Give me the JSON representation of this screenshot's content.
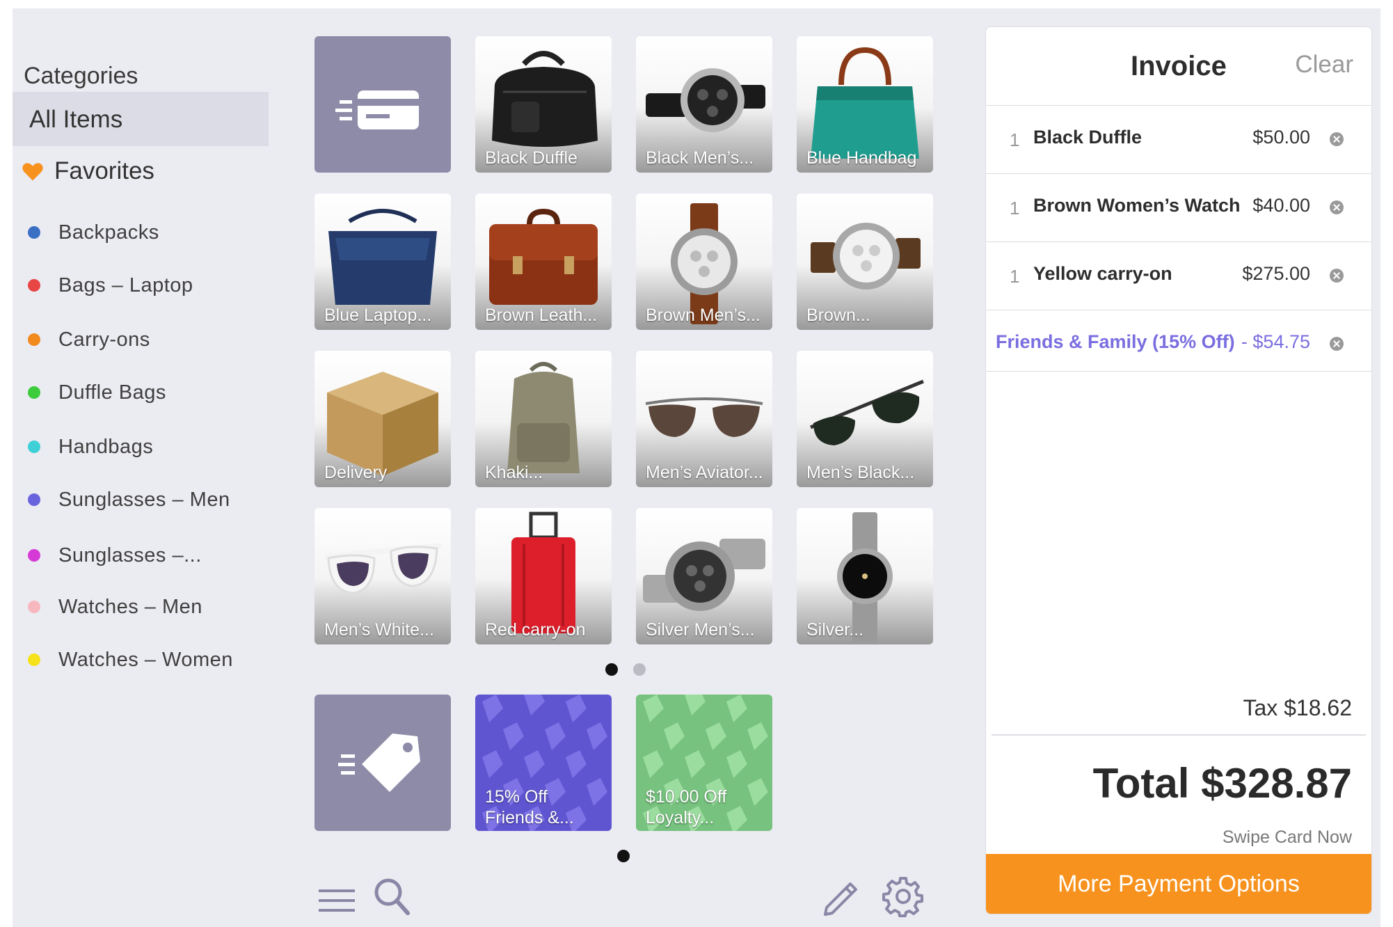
{
  "sidebar": {
    "title": "Categories",
    "all_items": "All Items",
    "favorites": "Favorites",
    "items": [
      {
        "label": "Backpacks",
        "color": "#3b6fc4"
      },
      {
        "label": "Bags – Laptop",
        "color": "#e84545"
      },
      {
        "label": "Carry-ons",
        "color": "#f2891d"
      },
      {
        "label": "Duffle Bags",
        "color": "#3ccc3c"
      },
      {
        "label": "Handbags",
        "color": "#3fcfd6"
      },
      {
        "label": "Sunglasses – Men",
        "color": "#6a63de"
      },
      {
        "label": "Sunglasses –...",
        "color": "#d63ad6"
      },
      {
        "label": "Watches – Men",
        "color": "#f7b7bf"
      },
      {
        "label": "Watches – Women",
        "color": "#f5e21a"
      }
    ]
  },
  "products": [
    {
      "label": "",
      "icon": "card-list-icon"
    },
    {
      "label": "Black Duffle",
      "icon": "duffle-bag-icon"
    },
    {
      "label": "Black Men’s...",
      "icon": "watch-icon"
    },
    {
      "label": "Blue Handbag",
      "icon": "handbag-icon"
    },
    {
      "label": "Blue Laptop...",
      "icon": "laptop-bag-icon"
    },
    {
      "label": "Brown Leath...",
      "icon": "briefcase-icon"
    },
    {
      "label": "Brown Men’s...",
      "icon": "watch-icon"
    },
    {
      "label": "Brown...",
      "icon": "watch-icon"
    },
    {
      "label": "Delivery",
      "icon": "box-icon"
    },
    {
      "label": "Khaki...",
      "icon": "backpack-icon"
    },
    {
      "label": "Men’s Aviator...",
      "icon": "aviator-sunglasses-icon"
    },
    {
      "label": "Men’s Black...",
      "icon": "sunglasses-icon"
    },
    {
      "label": "Men’s White...",
      "icon": "sunglasses-icon"
    },
    {
      "label": "Red carry-on",
      "icon": "suitcase-icon"
    },
    {
      "label": "Silver Men’s...",
      "icon": "watch-icon"
    },
    {
      "label": "Silver...",
      "icon": "watch-icon"
    }
  ],
  "discounts": [
    {
      "label": "",
      "icon": "tag-list-icon"
    },
    {
      "line1": "15% Off",
      "line2": "Friends &...",
      "color": "#5f55d1"
    },
    {
      "line1": "$10.00 Off",
      "line2": "Loyalty...",
      "color": "#76c27e"
    }
  ],
  "invoice": {
    "title": "Invoice",
    "clear": "Clear",
    "lines": [
      {
        "qty": "1",
        "name": "Black Duffle",
        "price": "$50.00"
      },
      {
        "qty": "1",
        "name": "Brown Women’s Watch",
        "price": "$40.00"
      },
      {
        "qty": "1",
        "name": "Yellow carry-on",
        "price": "$275.00"
      }
    ],
    "discount": {
      "name": "Friends & Family (15% Off)",
      "amount": "- $54.75"
    },
    "tax": "Tax $18.62",
    "total": "Total $328.87",
    "swipe": "Swipe Card Now",
    "pay_button": "More Payment Options"
  },
  "colors": {
    "accent": "#f7921e",
    "discount_text": "#7a6ee0",
    "favorite": "#f7921e",
    "action_tile": "#8e8ba8"
  }
}
